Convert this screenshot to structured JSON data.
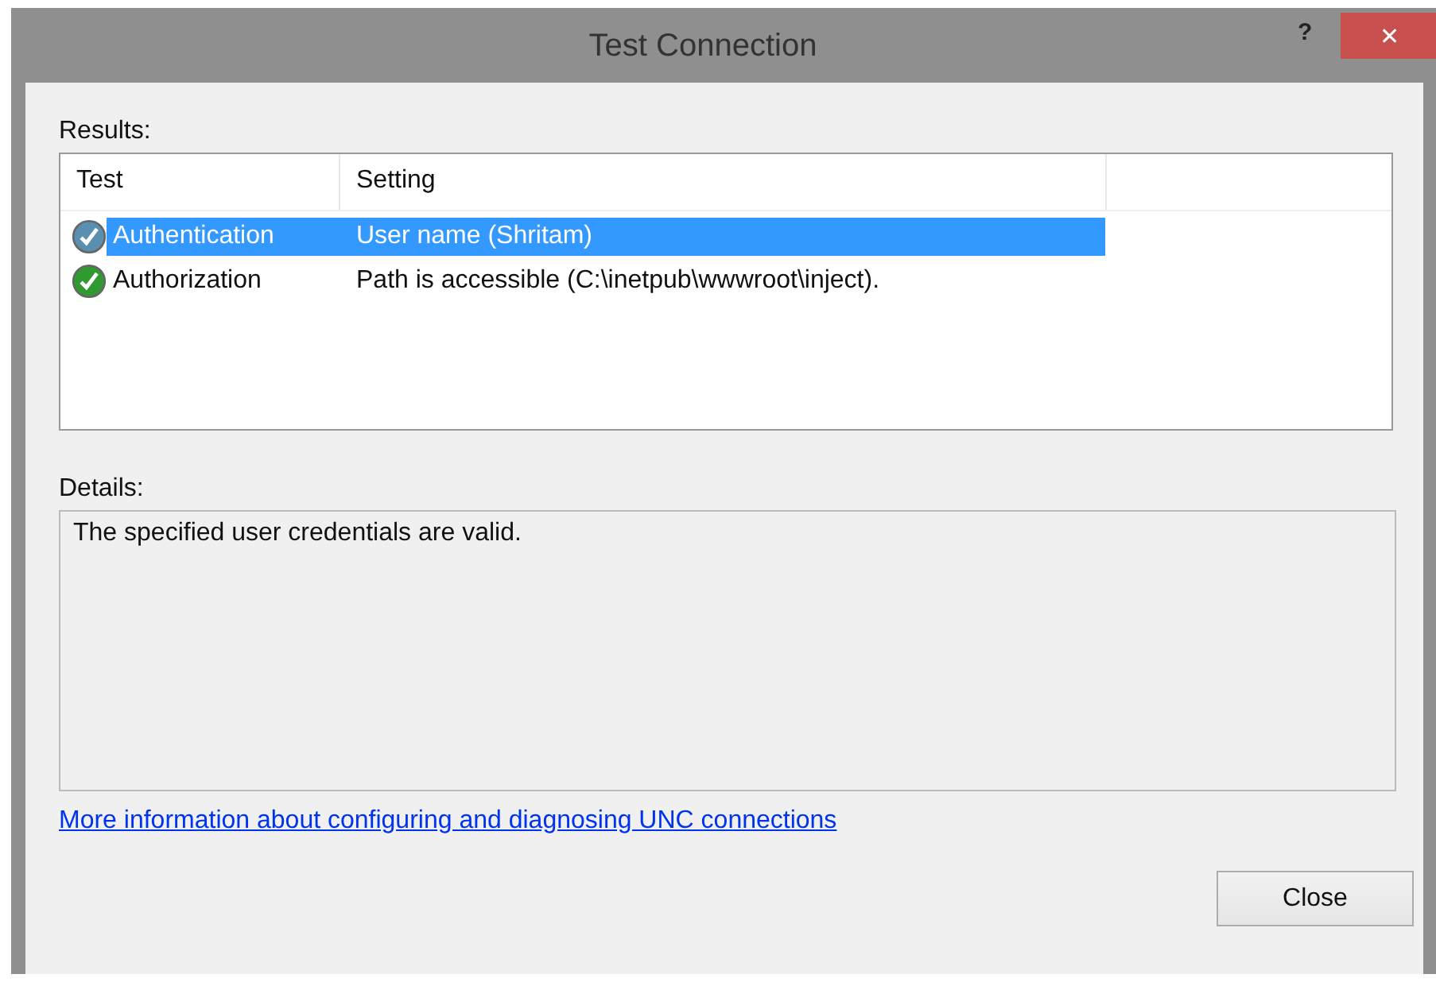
{
  "window": {
    "title": "Test Connection",
    "help": "?",
    "close": "✕"
  },
  "results": {
    "label": "Results:",
    "columns": [
      "Test",
      "Setting"
    ],
    "rows": [
      {
        "test": "Authentication",
        "setting": "User name (Shritam)",
        "selected": true
      },
      {
        "test": "Authorization",
        "setting": "Path is accessible (C:\\inetpub\\wwwroot\\inject).",
        "selected": false
      }
    ]
  },
  "details": {
    "label": "Details:",
    "text": "The specified user credentials are valid."
  },
  "link": "More information about configuring and diagnosing UNC connections",
  "buttons": [
    "Close"
  ]
}
